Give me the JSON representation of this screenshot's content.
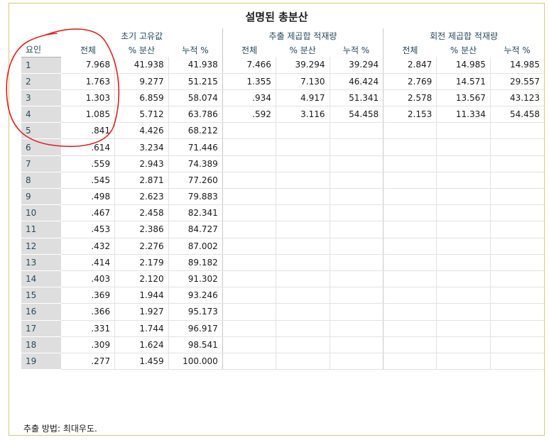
{
  "title": "설명된 총분산",
  "groups": [
    "초기 고유값",
    "추출 제곱합 적재량",
    "회전 제곱합 적재량"
  ],
  "row_header": "요인",
  "col_headers": [
    "전체",
    "% 분산",
    "누적 %",
    "전체",
    "% 분산",
    "누적 %",
    "전체",
    "% 분산",
    "누적 %"
  ],
  "rows": [
    {
      "factor": "1",
      "cells": [
        "7.968",
        "41.938",
        "41.938",
        "7.466",
        "39.294",
        "39.294",
        "2.847",
        "14.985",
        "14.985"
      ]
    },
    {
      "factor": "2",
      "cells": [
        "1.763",
        "9.277",
        "51.215",
        "1.355",
        "7.130",
        "46.424",
        "2.769",
        "14.571",
        "29.557"
      ]
    },
    {
      "factor": "3",
      "cells": [
        "1.303",
        "6.859",
        "58.074",
        ".934",
        "4.917",
        "51.341",
        "2.578",
        "13.567",
        "43.123"
      ]
    },
    {
      "factor": "4",
      "cells": [
        "1.085",
        "5.712",
        "63.786",
        ".592",
        "3.116",
        "54.458",
        "2.153",
        "11.334",
        "54.458"
      ]
    },
    {
      "factor": "5",
      "cells": [
        ".841",
        "4.426",
        "68.212",
        "",
        "",
        "",
        "",
        "",
        ""
      ]
    },
    {
      "factor": "6",
      "cells": [
        ".614",
        "3.234",
        "71.446",
        "",
        "",
        "",
        "",
        "",
        ""
      ]
    },
    {
      "factor": "7",
      "cells": [
        ".559",
        "2.943",
        "74.389",
        "",
        "",
        "",
        "",
        "",
        ""
      ]
    },
    {
      "factor": "8",
      "cells": [
        ".545",
        "2.871",
        "77.260",
        "",
        "",
        "",
        "",
        "",
        ""
      ]
    },
    {
      "factor": "9",
      "cells": [
        ".498",
        "2.623",
        "79.883",
        "",
        "",
        "",
        "",
        "",
        ""
      ]
    },
    {
      "factor": "10",
      "cells": [
        ".467",
        "2.458",
        "82.341",
        "",
        "",
        "",
        "",
        "",
        ""
      ]
    },
    {
      "factor": "11",
      "cells": [
        ".453",
        "2.386",
        "84.727",
        "",
        "",
        "",
        "",
        "",
        ""
      ]
    },
    {
      "factor": "12",
      "cells": [
        ".432",
        "2.276",
        "87.002",
        "",
        "",
        "",
        "",
        "",
        ""
      ]
    },
    {
      "factor": "13",
      "cells": [
        ".414",
        "2.179",
        "89.182",
        "",
        "",
        "",
        "",
        "",
        ""
      ]
    },
    {
      "factor": "14",
      "cells": [
        ".403",
        "2.120",
        "91.302",
        "",
        "",
        "",
        "",
        "",
        ""
      ]
    },
    {
      "factor": "15",
      "cells": [
        ".369",
        "1.944",
        "93.246",
        "",
        "",
        "",
        "",
        "",
        ""
      ]
    },
    {
      "factor": "16",
      "cells": [
        ".366",
        "1.927",
        "95.173",
        "",
        "",
        "",
        "",
        "",
        ""
      ]
    },
    {
      "factor": "17",
      "cells": [
        ".331",
        "1.744",
        "96.917",
        "",
        "",
        "",
        "",
        "",
        ""
      ]
    },
    {
      "factor": "18",
      "cells": [
        ".309",
        "1.624",
        "98.541",
        "",
        "",
        "",
        "",
        "",
        ""
      ]
    },
    {
      "factor": "19",
      "cells": [
        ".277",
        "1.459",
        "100.000",
        "",
        "",
        "",
        "",
        "",
        ""
      ]
    }
  ],
  "footnote": "추출 방법: 최대우도.",
  "colors": {
    "header_text": "#264a60",
    "label_bg": "#dedede",
    "frame_border": "#d9c87a",
    "annotation": "#e02020"
  }
}
